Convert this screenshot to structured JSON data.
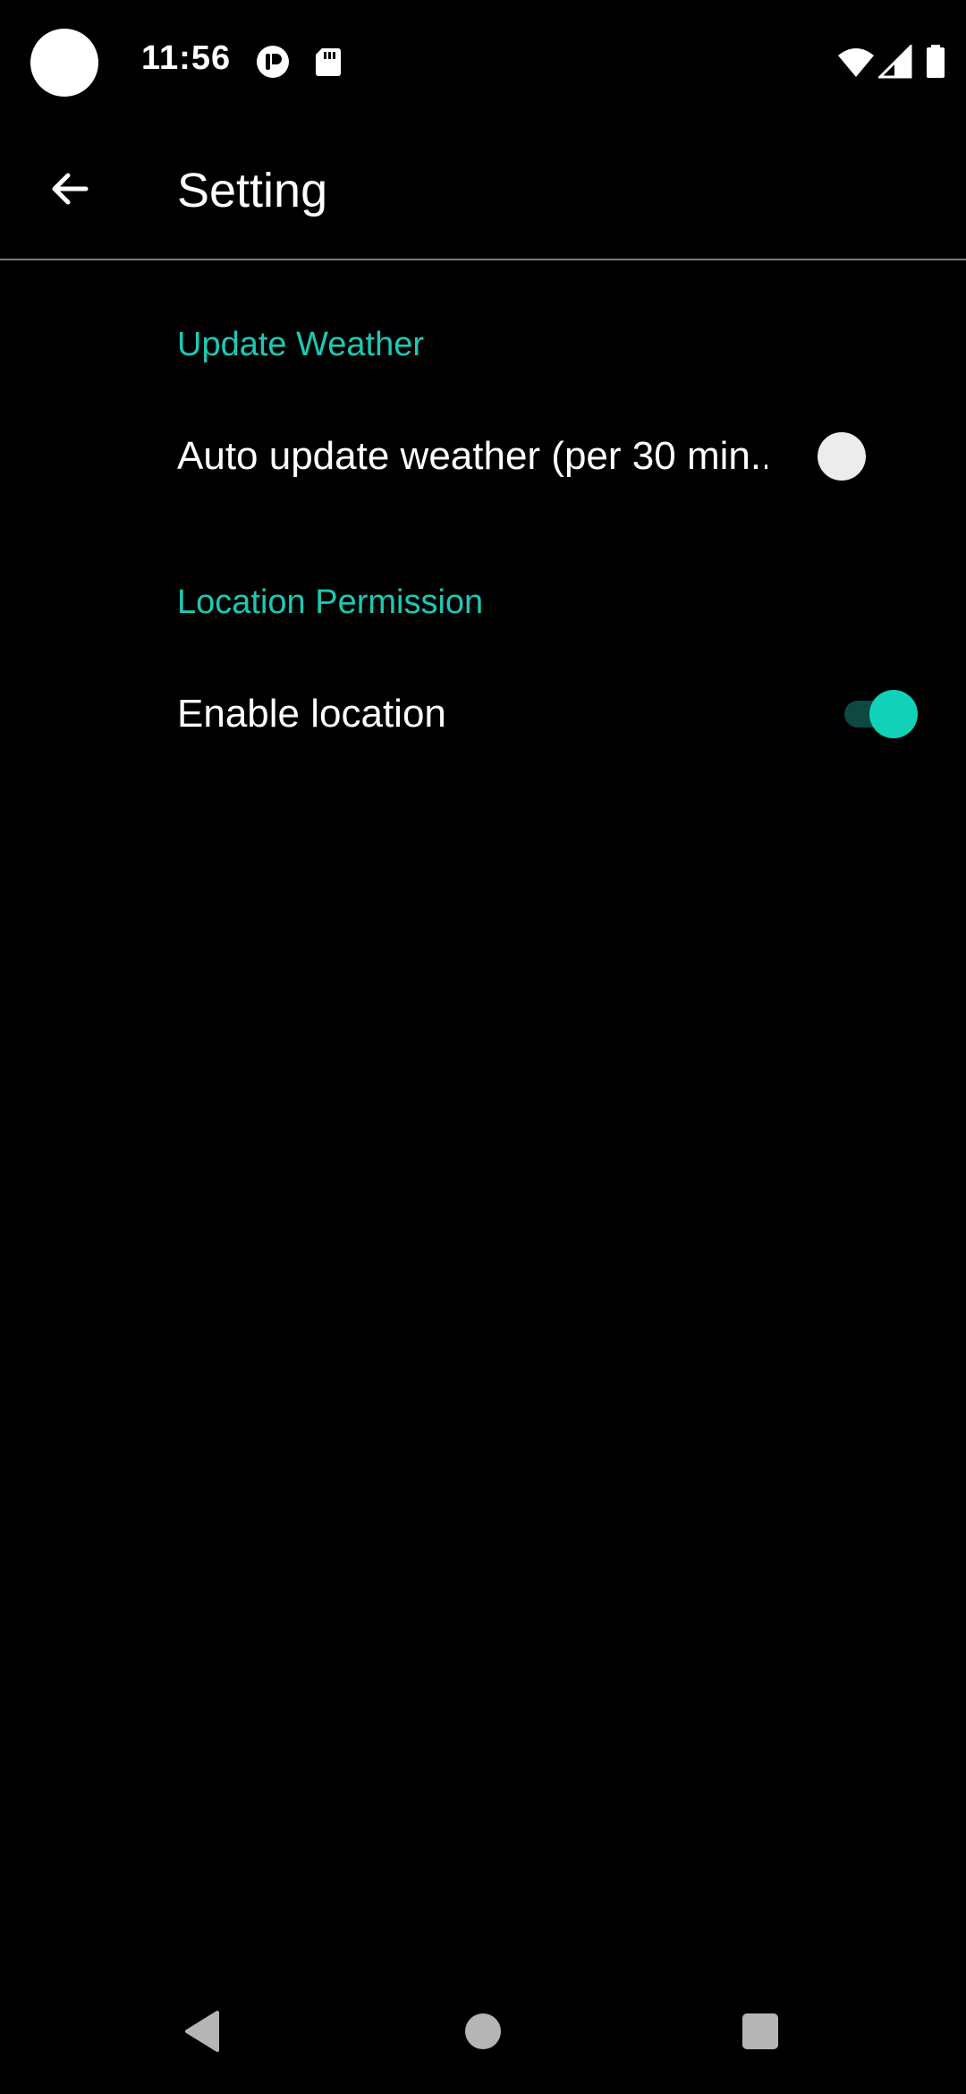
{
  "status_bar": {
    "time": "11:56",
    "icons": [
      "camera-cutout",
      "notification-app-icon",
      "sd-card-icon",
      "wifi-icon",
      "signal-icon",
      "battery-icon"
    ]
  },
  "toolbar": {
    "title": "Setting",
    "back_icon": "arrow-back-icon"
  },
  "sections": [
    {
      "header": "Update Weather",
      "item_label": "Auto update weather (per 30 min..",
      "switch_on": false
    },
    {
      "header": "Location Permission",
      "item_label": "Enable location",
      "switch_on": true
    }
  ],
  "nav_bar": {
    "buttons": [
      "back-triangle-icon",
      "home-circle-icon",
      "recents-square-icon"
    ]
  },
  "colors": {
    "background": "#000000",
    "accent": "#1ec8b4",
    "switch_on_thumb": "#11d2b8",
    "switch_on_track": "#0e4842",
    "switch_off_thumb": "#ececec",
    "divider": "#7a7a7a"
  }
}
